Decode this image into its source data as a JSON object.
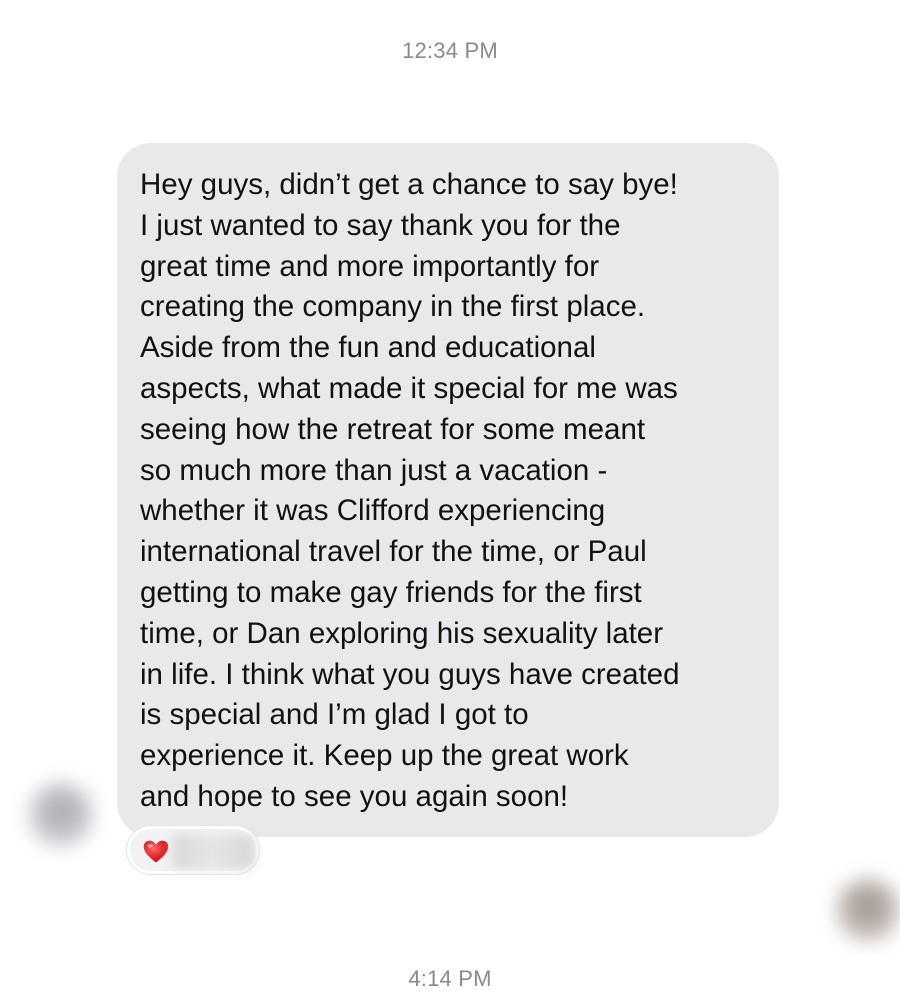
{
  "conversation": {
    "timestamp_top": "12:34 PM",
    "message": {
      "text": "Hey guys, didn’t get a chance to say bye!\nI just wanted to say thank you for the\ngreat time and more importantly for\ncreating the company in the first place.\nAside from the fun and educational\naspects, what made it special for me was\nseeing how the retreat for some meant\nso much more than just a vacation -\nwhether it was Clifford experiencing\ninternational travel for the time, or Paul\ngetting to make gay friends for the first\ntime, or Dan exploring his sexuality later\nin life. I think what you guys have created\nis special and I’m glad I got to\nexperience it. Keep up the great work\nand hope to see you again soon!",
      "bubble_color": "#e9e9eb"
    },
    "reaction": {
      "icon": "heart-icon",
      "color": "#e0242a"
    },
    "timestamp_bottom": "4:14 PM"
  }
}
